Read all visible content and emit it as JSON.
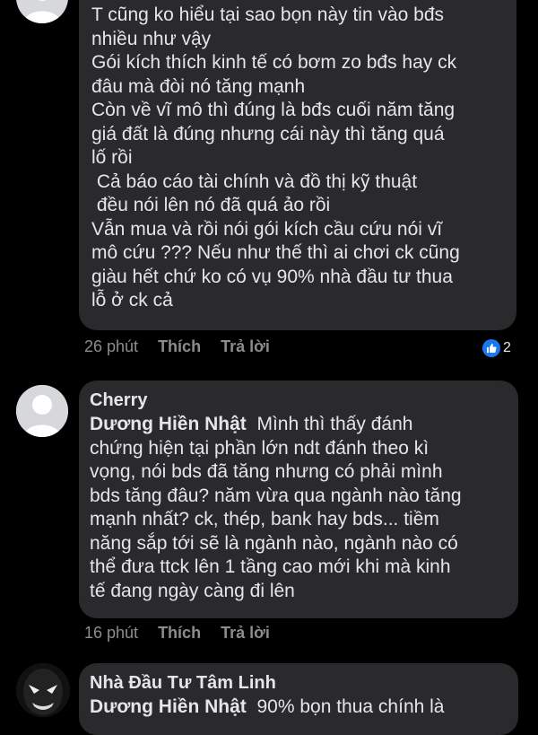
{
  "comments": [
    {
      "author": "",
      "mention": "",
      "text_lines": [
        "T cũng ko hiểu tại sao bọn này tin vào bđs",
        "nhiều như vậy",
        "Gói kích thích kinh tế có bơm zo bđs hay ck",
        "đâu mà đòi nó tăng mạnh",
        "Còn về vĩ mô thì đúng là bđs cuối năm tăng",
        "giá đất là đúng nhưng cái này thì tăng quá",
        "lố rồi",
        " Cả báo cáo tài chính và đồ thị kỹ thuật",
        " đều nói lên nó đã quá ảo rồi",
        "Vẫn mua và rồi nói gói kích cầu cứu nói vĩ",
        "mô cứu ??? Nếu như thế thì ai chơi ck cũng",
        "giàu hết chứ ko có vụ 90% nhà đầu tư thua",
        "lỗ ở ck cả"
      ],
      "time": "26 phút",
      "like_label": "Thích",
      "reply_label": "Trả lời",
      "reaction_count": "2"
    },
    {
      "author": "Cherry",
      "mention": "Dương Hiền Nhật",
      "text_first": "Mình thì thấy đánh",
      "text_lines": [
        "chứng hiện tại phần lớn ndt đánh theo kì",
        "vọng, nói bds đã tăng nhưng có phải mình",
        "bds tăng đâu? năm vừa qua ngành nào tăng",
        "mạnh nhất? ck, thép, bank hay bds... tiềm",
        "năng sắp tới sẽ là ngành nào, ngành nào có",
        "thể đưa ttck lên 1 tầng cao mới khi mà kinh",
        "tế đang ngày càng đi lên"
      ],
      "time": "16 phút",
      "like_label": "Thích",
      "reply_label": "Trả lời"
    },
    {
      "author": "Nhà Đầu Tư Tâm Linh",
      "mention": "Dương Hiền Nhật",
      "text_first": "90% bọn thua chính là"
    }
  ],
  "icons": {
    "like": "thumbs-up-icon",
    "avatar_default": "default-avatar-icon",
    "avatar_venom": "venom-avatar-icon"
  },
  "colors": {
    "background": "#000000",
    "bubble": "#2a2a2c",
    "text": "#e4e6eb",
    "meta": "#8a8d91",
    "like_blue": "#1877f2"
  }
}
